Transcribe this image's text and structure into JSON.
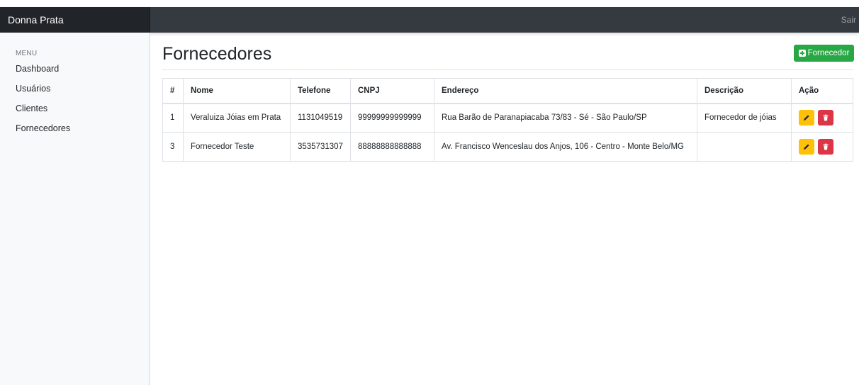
{
  "brand": "Donna Prata",
  "topbar": {
    "signout_label": "Sair"
  },
  "sidebar": {
    "heading": "MENU",
    "items": [
      {
        "label": "Dashboard"
      },
      {
        "label": "Usuários"
      },
      {
        "label": "Clientes"
      },
      {
        "label": "Fornecedores"
      }
    ]
  },
  "main": {
    "title": "Fornecedores",
    "add_button_label": "Fornecedor",
    "table": {
      "headers": [
        "#",
        "Nome",
        "Telefone",
        "CNPJ",
        "Endereço",
        "Descrição",
        "Ação"
      ],
      "rows": [
        [
          "1",
          "Veraluiza Jóias em Prata",
          "1131049519",
          "99999999999999",
          "Rua Barão de Paranapiacaba 73/83 - Sé - São Paulo/SP",
          "Fornecedor de jóias"
        ],
        [
          "3",
          "Fornecedor Teste",
          "3535731307",
          "88888888888888",
          "Av. Francisco Wenceslau dos Anjos, 106 - Centro - Monte Belo/MG",
          ""
        ]
      ]
    }
  },
  "colors": {
    "topbar": "#343a40",
    "brand_bg": "#212529",
    "success": "#28a745",
    "warning": "#ffc107",
    "danger": "#dc3545"
  },
  "icons": [
    "plus-square-icon",
    "pencil-icon",
    "trash-icon"
  ]
}
